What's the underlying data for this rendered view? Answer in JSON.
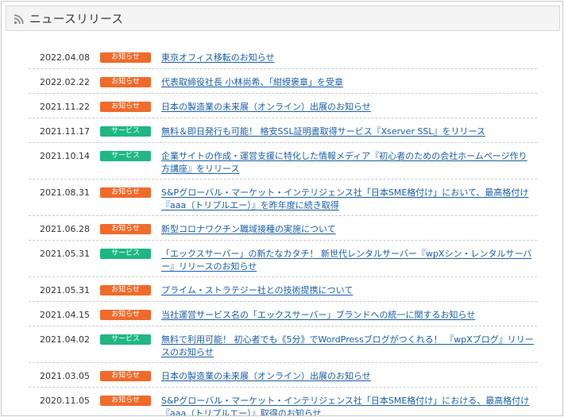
{
  "header": {
    "title": "ニュースリリース",
    "icon": "rss-icon"
  },
  "colors": {
    "notice": "#f06a2a",
    "service": "#1fb783",
    "link": "#1a5ea8"
  },
  "news": [
    {
      "date": "2022.04.08",
      "badge": "お知らせ",
      "type": "notice",
      "title": "東京オフィス移転のお知らせ"
    },
    {
      "date": "2022.02.22",
      "badge": "お知らせ",
      "type": "notice",
      "title": "代表取締役社長 小林尚希、「紺綬褒章」を受章"
    },
    {
      "date": "2021.11.22",
      "badge": "お知らせ",
      "type": "notice",
      "title": "日本の製造業の未来展（オンライン）出展のお知らせ"
    },
    {
      "date": "2021.11.17",
      "badge": "サービス",
      "type": "service",
      "title": "無料＆即日発行も可能！ 格安SSL証明書取得サービス『Xserver SSL』をリリース"
    },
    {
      "date": "2021.10.14",
      "badge": "サービス",
      "type": "service",
      "title": "企業サイトの作成・運営支援に特化した情報メディア『初心者のための会社ホームページ作り方講座』をリリース"
    },
    {
      "date": "2021.08.31",
      "badge": "お知らせ",
      "type": "notice",
      "title": "S&Pグローバル・マーケット・インテリジェンス社「日本SME格付け」において、最高格付け『aaa（トリプルエー）』を昨年度に続き取得"
    },
    {
      "date": "2021.06.28",
      "badge": "お知らせ",
      "type": "notice",
      "title": "新型コロナワクチン職域接種の実施について"
    },
    {
      "date": "2021.05.31",
      "badge": "サービス",
      "type": "service",
      "title": "「エックスサーバー」の新たなカタチ！ 新世代レンタルサーバー『wpXシン・レンタルサーバー』リリースのお知らせ"
    },
    {
      "date": "2021.05.31",
      "badge": "お知らせ",
      "type": "notice",
      "title": "プライム・ストラテジー社との技術提携について"
    },
    {
      "date": "2021.04.15",
      "badge": "お知らせ",
      "type": "notice",
      "title": "当社運営サービス名の「エックスサーバー」ブランドへの統一に関するお知らせ"
    },
    {
      "date": "2021.04.02",
      "badge": "サービス",
      "type": "service",
      "title": "無料で利用可能！ 初心者でも《5分》でWordPressブログがつくれる！ 『wpXブログ』リリースのお知らせ"
    },
    {
      "date": "2021.03.05",
      "badge": "お知らせ",
      "type": "notice",
      "title": "日本の製造業の未来展（オンライン）出展のお知らせ"
    },
    {
      "date": "2020.11.05",
      "badge": "お知らせ",
      "type": "notice",
      "title": "S&Pグローバル・マーケット・インテリジェンス社「日本SME格付け」における、最高格付け『aaa（トリプルエー）』取得のお知らせ"
    }
  ]
}
